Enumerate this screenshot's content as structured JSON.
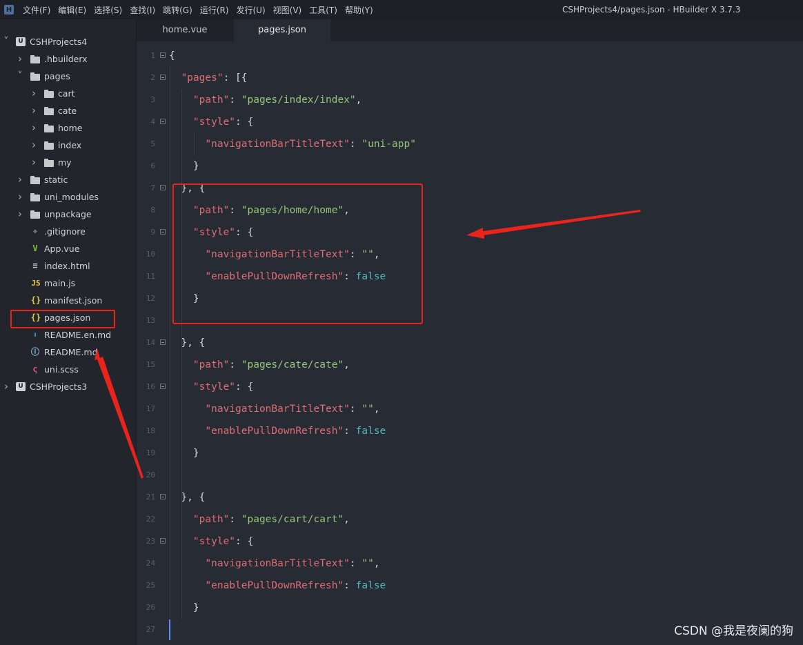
{
  "app": {
    "logo_letter": "H",
    "window_title": "CSHProjects4/pages.json - HBuilder X 3.7.3"
  },
  "menu": [
    "文件(F)",
    "编辑(E)",
    "选择(S)",
    "查找(I)",
    "跳转(G)",
    "运行(R)",
    "发行(U)",
    "视图(V)",
    "工具(T)",
    "帮助(Y)"
  ],
  "sidebar": {
    "items": [
      {
        "label": "CSHProjects4",
        "depth": 0,
        "kind": "project",
        "expanded": true
      },
      {
        "label": ".hbuilderx",
        "depth": 1,
        "kind": "folder",
        "expanded": false
      },
      {
        "label": "pages",
        "depth": 1,
        "kind": "folder-open",
        "expanded": true
      },
      {
        "label": "cart",
        "depth": 2,
        "kind": "folder",
        "expanded": false
      },
      {
        "label": "cate",
        "depth": 2,
        "kind": "folder",
        "expanded": false
      },
      {
        "label": "home",
        "depth": 2,
        "kind": "folder",
        "expanded": false
      },
      {
        "label": "index",
        "depth": 2,
        "kind": "folder",
        "expanded": false
      },
      {
        "label": "my",
        "depth": 2,
        "kind": "folder",
        "expanded": false
      },
      {
        "label": "static",
        "depth": 1,
        "kind": "folder",
        "expanded": false
      },
      {
        "label": "uni_modules",
        "depth": 1,
        "kind": "folder",
        "expanded": false
      },
      {
        "label": "unpackage",
        "depth": 1,
        "kind": "folder",
        "expanded": false
      },
      {
        "label": ".gitignore",
        "depth": 1,
        "kind": "gitignore"
      },
      {
        "label": "App.vue",
        "depth": 1,
        "kind": "vue"
      },
      {
        "label": "index.html",
        "depth": 1,
        "kind": "html"
      },
      {
        "label": "main.js",
        "depth": 1,
        "kind": "js"
      },
      {
        "label": "manifest.json",
        "depth": 1,
        "kind": "json"
      },
      {
        "label": "pages.json",
        "depth": 1,
        "kind": "json",
        "selected": true
      },
      {
        "label": "README.en.md",
        "depth": 1,
        "kind": "md-download"
      },
      {
        "label": "README.md",
        "depth": 1,
        "kind": "md-info"
      },
      {
        "label": "uni.scss",
        "depth": 1,
        "kind": "scss"
      },
      {
        "label": "CSHProjects3",
        "depth": 0,
        "kind": "project",
        "expanded": false
      }
    ]
  },
  "tabs": [
    {
      "label": "home.vue",
      "active": false
    },
    {
      "label": "pages.json",
      "active": true
    }
  ],
  "editor": {
    "lines": [
      {
        "n": "1",
        "fold": true,
        "tokens": [
          [
            "p",
            "{"
          ]
        ]
      },
      {
        "n": "2",
        "fold": true,
        "tokens": [
          [
            "k",
            "\"pages\""
          ],
          [
            "p",
            ": [{"
          ]
        ]
      },
      {
        "n": "3",
        "fold": false,
        "tokens": [
          [
            "k",
            "\"path\""
          ],
          [
            "p",
            ": "
          ],
          [
            "s",
            "\"pages/index/index\""
          ],
          [
            "p",
            ","
          ]
        ]
      },
      {
        "n": "4",
        "fold": true,
        "tokens": [
          [
            "k",
            "\"style\""
          ],
          [
            "p",
            ": {"
          ]
        ]
      },
      {
        "n": "5",
        "fold": false,
        "tokens": [
          [
            "k",
            "\"navigationBarTitleText\""
          ],
          [
            "p",
            ": "
          ],
          [
            "s",
            "\"uni-app\""
          ]
        ]
      },
      {
        "n": "6",
        "fold": false,
        "tokens": [
          [
            "p",
            "}"
          ]
        ]
      },
      {
        "n": "7",
        "fold": true,
        "tokens": [
          [
            "p",
            "}, {"
          ]
        ]
      },
      {
        "n": "8",
        "fold": false,
        "tokens": [
          [
            "k",
            "\"path\""
          ],
          [
            "p",
            ": "
          ],
          [
            "s",
            "\"pages/home/home\""
          ],
          [
            "p",
            ","
          ]
        ]
      },
      {
        "n": "9",
        "fold": true,
        "tokens": [
          [
            "k",
            "\"style\""
          ],
          [
            "p",
            ": {"
          ]
        ]
      },
      {
        "n": "10",
        "fold": false,
        "tokens": [
          [
            "k",
            "\"navigationBarTitleText\""
          ],
          [
            "p",
            ": "
          ],
          [
            "s",
            "\"\""
          ],
          [
            "p",
            ","
          ]
        ]
      },
      {
        "n": "11",
        "fold": false,
        "tokens": [
          [
            "k",
            "\"enablePullDownRefresh\""
          ],
          [
            "p",
            ": "
          ],
          [
            "b",
            "false"
          ]
        ]
      },
      {
        "n": "12",
        "fold": false,
        "tokens": [
          [
            "p",
            "}"
          ]
        ]
      },
      {
        "n": "13",
        "fold": false,
        "tokens": []
      },
      {
        "n": "14",
        "fold": true,
        "tokens": [
          [
            "p",
            "}, {"
          ]
        ]
      },
      {
        "n": "15",
        "fold": false,
        "tokens": [
          [
            "k",
            "\"path\""
          ],
          [
            "p",
            ": "
          ],
          [
            "s",
            "\"pages/cate/cate\""
          ],
          [
            "p",
            ","
          ]
        ]
      },
      {
        "n": "16",
        "fold": true,
        "tokens": [
          [
            "k",
            "\"style\""
          ],
          [
            "p",
            ": {"
          ]
        ]
      },
      {
        "n": "17",
        "fold": false,
        "tokens": [
          [
            "k",
            "\"navigationBarTitleText\""
          ],
          [
            "p",
            ": "
          ],
          [
            "s",
            "\"\""
          ],
          [
            "p",
            ","
          ]
        ]
      },
      {
        "n": "18",
        "fold": false,
        "tokens": [
          [
            "k",
            "\"enablePullDownRefresh\""
          ],
          [
            "p",
            ": "
          ],
          [
            "b",
            "false"
          ]
        ]
      },
      {
        "n": "19",
        "fold": false,
        "tokens": [
          [
            "p",
            "}"
          ]
        ]
      },
      {
        "n": "20",
        "fold": false,
        "tokens": []
      },
      {
        "n": "21",
        "fold": true,
        "tokens": [
          [
            "p",
            "}, {"
          ]
        ]
      },
      {
        "n": "22",
        "fold": false,
        "tokens": [
          [
            "k",
            "\"path\""
          ],
          [
            "p",
            ": "
          ],
          [
            "s",
            "\"pages/cart/cart\""
          ],
          [
            "p",
            ","
          ]
        ]
      },
      {
        "n": "23",
        "fold": true,
        "tokens": [
          [
            "k",
            "\"style\""
          ],
          [
            "p",
            ": {"
          ]
        ]
      },
      {
        "n": "24",
        "fold": false,
        "tokens": [
          [
            "k",
            "\"navigationBarTitleText\""
          ],
          [
            "p",
            ": "
          ],
          [
            "s",
            "\"\""
          ],
          [
            "p",
            ","
          ]
        ]
      },
      {
        "n": "25",
        "fold": false,
        "tokens": [
          [
            "k",
            "\"enablePullDownRefresh\""
          ],
          [
            "p",
            ": "
          ],
          [
            "b",
            "false"
          ]
        ]
      },
      {
        "n": "26",
        "fold": false,
        "tokens": [
          [
            "p",
            "}"
          ]
        ]
      },
      {
        "n": "27",
        "fold": false,
        "tokens": []
      }
    ]
  },
  "colors": {
    "annotation": "#e8241c",
    "key": "#e06c75",
    "string": "#98c379",
    "boolean": "#56b6c2"
  },
  "watermark": "CSDN @我是夜阑的狗"
}
